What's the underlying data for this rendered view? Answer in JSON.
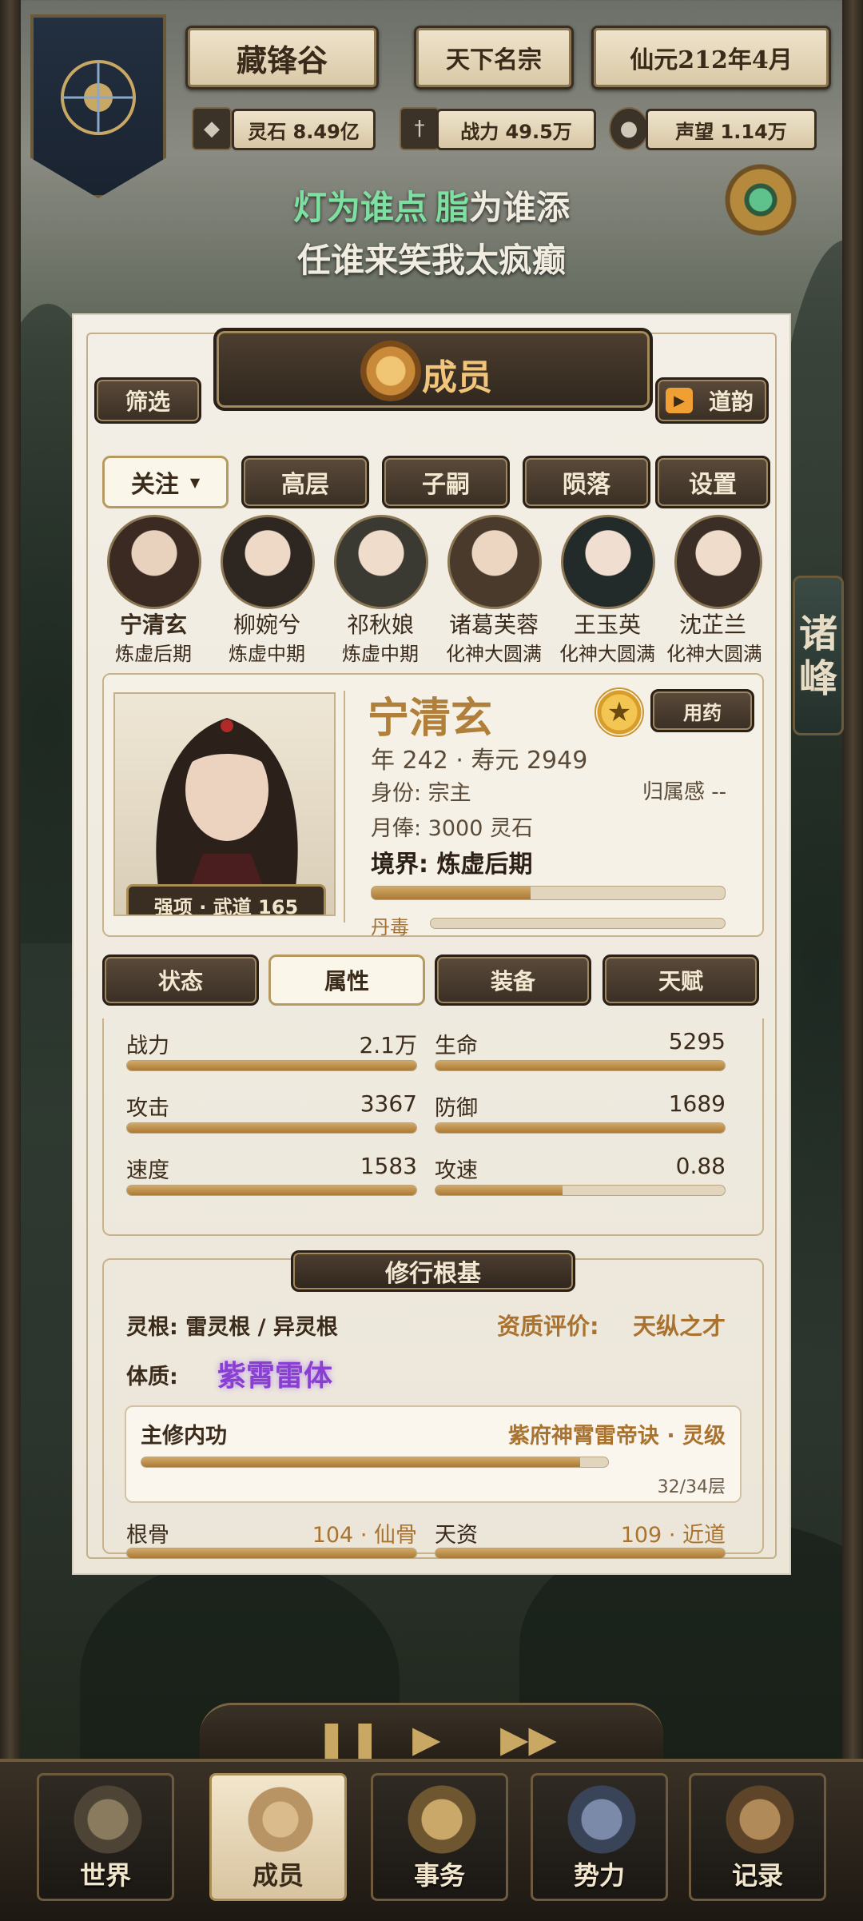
{
  "header": {
    "sect_name": "藏锋谷",
    "sect_title": "天下名宗",
    "date": "仙元212年4月",
    "spirit_stone": "灵石 8.49亿",
    "combat_power": "战力 49.5万",
    "prestige": "声望 1.14万"
  },
  "poem": {
    "line1_green": "灯为谁点",
    "line1_rest_green": "脂",
    "line1_rest": "为谁添",
    "line2": "任谁来笑我太疯癫"
  },
  "side_tab": "诸峰",
  "panel": {
    "title": "成员",
    "filter_label": "筛选",
    "daoyun_label": "道韵",
    "tabs": [
      "关注",
      "高层",
      "子嗣",
      "陨落",
      "设置"
    ],
    "dropdown_arrow": "▼",
    "members": [
      {
        "name": "宁清玄",
        "rank": "炼虚后期"
      },
      {
        "name": "柳婉兮",
        "rank": "炼虚中期"
      },
      {
        "name": "祁秋娘",
        "rank": "炼虚中期"
      },
      {
        "name": "诸葛芙蓉",
        "rank": "化神大圆满"
      },
      {
        "name": "王玉英",
        "rank": "化神大圆满"
      },
      {
        "name": "沈芷兰",
        "rank": "化神大圆满"
      }
    ],
    "detail": {
      "name": "宁清玄",
      "use_medicine": "用药",
      "age_life": "年 242 · 寿元 2949",
      "identity": "身份: 宗主",
      "belonging": "归属感 --",
      "salary": "月俸: 3000 灵石",
      "realm": "境界: 炼虚后期",
      "cultivation_progress": 0.45,
      "poison_label": "丹毒",
      "poison_progress": 0,
      "strength": "强项 · 武道 165"
    },
    "sub_tabs": [
      "状态",
      "属性",
      "装备",
      "天赋"
    ],
    "attributes": [
      {
        "label": "战力",
        "value": "2.1万",
        "fill": 1.0
      },
      {
        "label": "生命",
        "value": "5295",
        "fill": 1.0
      },
      {
        "label": "攻击",
        "value": "3367",
        "fill": 1.0
      },
      {
        "label": "防御",
        "value": "1689",
        "fill": 1.0
      },
      {
        "label": "速度",
        "value": "1583",
        "fill": 1.0
      },
      {
        "label": "攻速",
        "value": "0.88",
        "fill": 0.44
      }
    ],
    "cultivation": {
      "title": "修行根基",
      "root": "灵根: 雷灵根 / 异灵根",
      "aptitude_label": "资质评价:",
      "aptitude_value": "天纵之才",
      "physique_label": "体质:",
      "physique_value": "紫霄雷体",
      "technique_label": "主修内功",
      "technique_name": "紫府神霄雷帝诀 · 灵级",
      "technique_level": "32/34层",
      "technique_progress": 0.94,
      "bone_label": "根骨",
      "bone_value": "104 · 仙骨",
      "talent_label": "天资",
      "talent_value": "109 · 近道"
    }
  },
  "nav": [
    "世界",
    "成员",
    "事务",
    "势力",
    "记录"
  ],
  "colors": {
    "accent_gold": "#c89a4e",
    "green_text": "#7ee0a0",
    "purple_text": "#8a3fd0"
  }
}
